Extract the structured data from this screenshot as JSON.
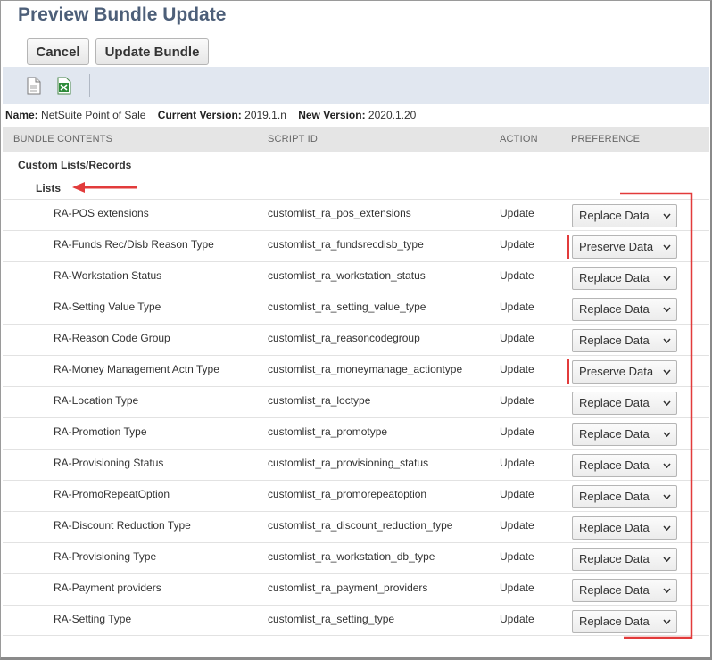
{
  "title": "Preview Bundle Update",
  "buttons": {
    "cancel": "Cancel",
    "update": "Update Bundle"
  },
  "toolbar": {
    "doc_icon": "document-icon",
    "xls_icon": "excel-icon"
  },
  "info": {
    "name_label": "Name:",
    "name_value": "NetSuite Point of Sale",
    "current_label": "Current Version:",
    "current_value": "2019.1.n",
    "new_label": "New Version:",
    "new_value": "2020.1.20"
  },
  "columns": {
    "contents": "BUNDLE CONTENTS",
    "script": "SCRIPT ID",
    "action": "ACTION",
    "preference": "PREFERENCE"
  },
  "sections": {
    "custom": "Custom Lists/Records",
    "lists": "Lists"
  },
  "rows": [
    {
      "name": "RA-POS extensions",
      "script_id": "customlist_ra_pos_extensions",
      "action": "Update",
      "preference": "Replace Data"
    },
    {
      "name": "RA-Funds Rec/Disb Reason Type",
      "script_id": "customlist_ra_fundsrecdisb_type",
      "action": "Update",
      "preference": "Preserve Data"
    },
    {
      "name": "RA-Workstation Status",
      "script_id": "customlist_ra_workstation_status",
      "action": "Update",
      "preference": "Replace Data"
    },
    {
      "name": "RA-Setting Value Type",
      "script_id": "customlist_ra_setting_value_type",
      "action": "Update",
      "preference": "Replace Data"
    },
    {
      "name": "RA-Reason Code Group",
      "script_id": "customlist_ra_reasoncodegroup",
      "action": "Update",
      "preference": "Replace Data"
    },
    {
      "name": "RA-Money Management Actn Type",
      "script_id": "customlist_ra_moneymanage_actiontype",
      "action": "Update",
      "preference": "Preserve Data"
    },
    {
      "name": "RA-Location Type",
      "script_id": "customlist_ra_loctype",
      "action": "Update",
      "preference": "Replace Data"
    },
    {
      "name": "RA-Promotion Type",
      "script_id": "customlist_ra_promotype",
      "action": "Update",
      "preference": "Replace Data"
    },
    {
      "name": "RA-Provisioning Status",
      "script_id": "customlist_ra_provisioning_status",
      "action": "Update",
      "preference": "Replace Data"
    },
    {
      "name": "RA-PromoRepeatOption",
      "script_id": "customlist_ra_promorepeatoption",
      "action": "Update",
      "preference": "Replace Data"
    },
    {
      "name": "RA-Discount Reduction Type",
      "script_id": "customlist_ra_discount_reduction_type",
      "action": "Update",
      "preference": "Replace Data"
    },
    {
      "name": "RA-Provisioning Type",
      "script_id": "customlist_ra_workstation_db_type",
      "action": "Update",
      "preference": "Replace Data"
    },
    {
      "name": "RA-Payment providers",
      "script_id": "customlist_ra_payment_providers",
      "action": "Update",
      "preference": "Replace Data"
    },
    {
      "name": "RA-Setting Type",
      "script_id": "customlist_ra_setting_type",
      "action": "Update",
      "preference": "Replace Data"
    }
  ],
  "colors": {
    "title": "#4d5f79",
    "toolbar_bg": "#e1e7f0",
    "annotation_red": "#e23b3b"
  }
}
